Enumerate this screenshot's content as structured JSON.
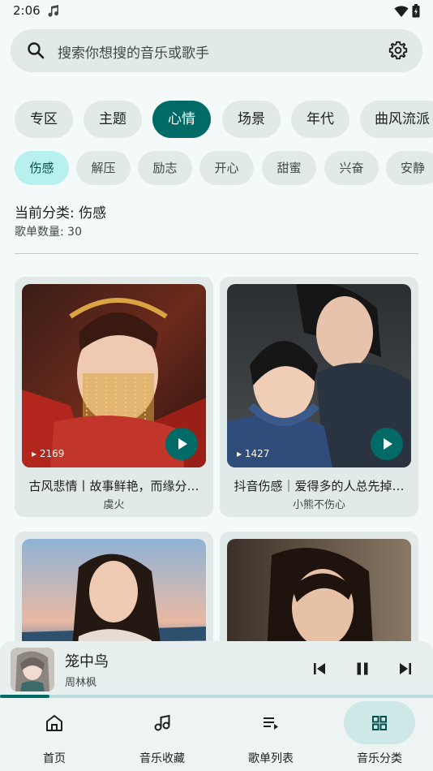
{
  "status": {
    "time": "2:06"
  },
  "search": {
    "placeholder": "搜索你想搜的音乐或歌手"
  },
  "categories": [
    {
      "label": "专区",
      "active": false
    },
    {
      "label": "主题",
      "active": false
    },
    {
      "label": "心情",
      "active": true
    },
    {
      "label": "场景",
      "active": false
    },
    {
      "label": "年代",
      "active": false
    },
    {
      "label": "曲风流派",
      "active": false
    }
  ],
  "moods": [
    {
      "label": "伤感",
      "active": true
    },
    {
      "label": "解压",
      "active": false
    },
    {
      "label": "励志",
      "active": false
    },
    {
      "label": "开心",
      "active": false
    },
    {
      "label": "甜蜜",
      "active": false
    },
    {
      "label": "兴奋",
      "active": false
    },
    {
      "label": "安静",
      "active": false
    }
  ],
  "summary": {
    "current": "当前分类: 伤感",
    "count": "歌单数量: 30"
  },
  "playlists": [
    {
      "play_count": "2169",
      "title": "古风悲情丨故事鲜艳，而缘分…",
      "author": "虞火"
    },
    {
      "play_count": "1427",
      "title": "抖音伤感｜爱得多的人总先掉…",
      "author": "小熊不伤心"
    },
    {
      "play_count": "",
      "title": "",
      "author": ""
    },
    {
      "play_count": "",
      "title": "",
      "author": ""
    }
  ],
  "player": {
    "title": "笼中鸟",
    "artist": "周林枫",
    "progress": 0.115
  },
  "nav": {
    "items": [
      {
        "label": "首页",
        "icon": "home-icon",
        "active": false
      },
      {
        "label": "音乐收藏",
        "icon": "music-note-icon",
        "active": false
      },
      {
        "label": "歌单列表",
        "icon": "playlist-icon",
        "active": false
      },
      {
        "label": "音乐分类",
        "icon": "grid-category-icon",
        "active": true
      }
    ]
  },
  "colors": {
    "accent": "#006a66",
    "accent_light": "#b7f0ee",
    "surface": "#e2e9e9",
    "background": "#f4fafa"
  }
}
